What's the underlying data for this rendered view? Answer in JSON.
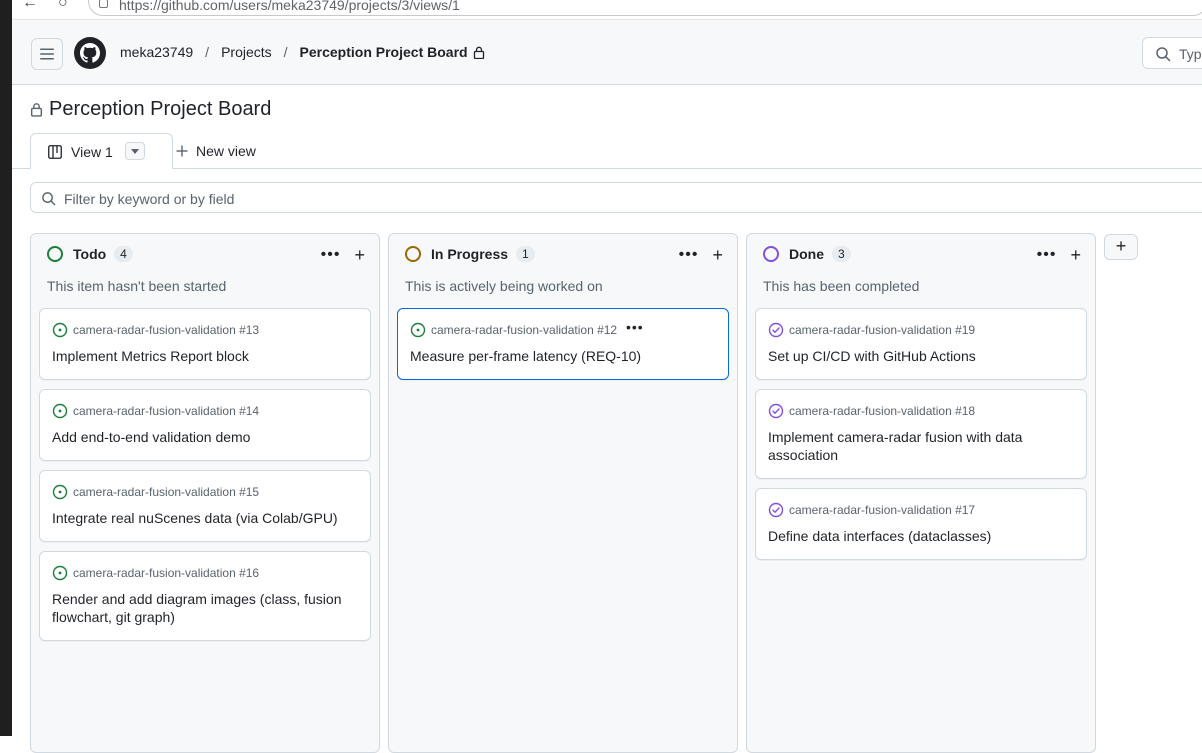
{
  "browser": {
    "url": "https://github.com/users/meka23749/projects/3/views/1"
  },
  "header": {
    "breadcrumb": {
      "user": "meka23749",
      "projects": "Projects",
      "current": "Perception Project Board"
    },
    "search_placeholder": "Type"
  },
  "project": {
    "title": "Perception Project Board"
  },
  "views": {
    "active_tab": "View 1",
    "new_view_label": "New view"
  },
  "filter": {
    "placeholder": "Filter by keyword or by field"
  },
  "colors": {
    "todo": "#1a7f37",
    "in_progress": "#9a6700",
    "done": "#8250df",
    "accent": "#0969da"
  },
  "columns": [
    {
      "name": "Todo",
      "count": "4",
      "description": "This item hasn't been started",
      "cards": [
        {
          "repo": "camera-radar-fusion-validation #13",
          "title": "Implement Metrics Report block",
          "state": "open"
        },
        {
          "repo": "camera-radar-fusion-validation #14",
          "title": "Add end-to-end validation demo",
          "state": "open"
        },
        {
          "repo": "camera-radar-fusion-validation #15",
          "title": "Integrate real nuScenes data (via Colab/GPU)",
          "state": "open"
        },
        {
          "repo": "camera-radar-fusion-validation #16",
          "title": "Render and add diagram images (class, fusion flowchart, git graph)",
          "state": "open"
        }
      ]
    },
    {
      "name": "In Progress",
      "count": "1",
      "description": "This is actively being worked on",
      "cards": [
        {
          "repo": "camera-radar-fusion-validation #12",
          "title": "Measure per-frame latency (REQ-10)",
          "state": "open"
        }
      ]
    },
    {
      "name": "Done",
      "count": "3",
      "description": "This has been completed",
      "cards": [
        {
          "repo": "camera-radar-fusion-validation #19",
          "title": "Set up CI/CD with GitHub Actions",
          "state": "closed"
        },
        {
          "repo": "camera-radar-fusion-validation #18",
          "title": "Implement camera-radar fusion with data association",
          "state": "closed"
        },
        {
          "repo": "camera-radar-fusion-validation #17",
          "title": "Define data interfaces (dataclasses)",
          "state": "closed"
        }
      ]
    }
  ]
}
